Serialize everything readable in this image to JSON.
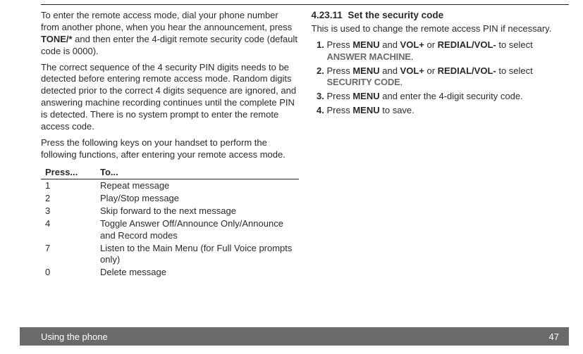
{
  "col1": {
    "para1_pre": "To enter the remote access mode, dial your phone number from another phone, when you hear the announcement, press ",
    "para1_bold": "TONE/*",
    "para1_post": " and then enter the 4-digit remote security code (default code is 0000).",
    "para2": "The correct sequence of the 4 security PIN digits needs to be detected before entering remote access mode. Random digits detected prior to the correct 4 digits sequence are ignored, and answering machine recording continues until the complete PIN is detected. There is no system prompt to enter the remote access code.",
    "para3": "Press the following keys on your handset to perform the following functions, after entering your remote access mode.",
    "table": {
      "head_press": "Press...",
      "head_to": "To...",
      "rows": [
        {
          "k": "1",
          "v": "Repeat message"
        },
        {
          "k": "2",
          "v": "Play/Stop message"
        },
        {
          "k": "3",
          "v": "Skip forward to the next message"
        },
        {
          "k": "4",
          "v": "Toggle Answer Off/Announce Only/Announce and Record modes"
        },
        {
          "k": "7",
          "v": "Listen to the Main Menu (for Full Voice prompts only)"
        },
        {
          "k": "0",
          "v": "Delete message"
        }
      ]
    }
  },
  "col2": {
    "heading_num": "4.23.11",
    "heading_txt": "Set the security code",
    "intro": "This is used to change the remote access PIN if necessary.",
    "s1_a": "Press ",
    "s1_b": "MENU",
    "s1_c": " and ",
    "s1_d": "VOL+",
    "s1_e": " or ",
    "s1_f": "REDIAL/VOL-",
    "s1_g": " to select ",
    "s1_h": "ANSWER MACHINE",
    "s1_i": ".",
    "s2_a": "Press ",
    "s2_b": "MENU",
    "s2_c": " and ",
    "s2_d": "VOL+",
    "s2_e": " or ",
    "s2_f": "REDIAL/VOL-",
    "s2_g": " to select ",
    "s2_h": "SECURITY CODE",
    "s2_i": ".",
    "s3_a": "Press ",
    "s3_b": "MENU",
    "s3_c": " and enter the 4-digit security code.",
    "s4_a": "Press ",
    "s4_b": "MENU",
    "s4_c": " to save."
  },
  "footer": {
    "section": "Using the phone",
    "page": "47"
  }
}
